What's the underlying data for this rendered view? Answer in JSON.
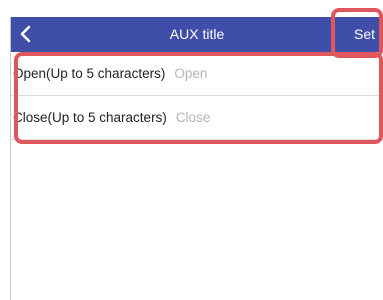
{
  "header": {
    "title": "AUX title",
    "set_label": "Set",
    "back_icon": "chevron-left-icon",
    "background_color": "#3f4ea8"
  },
  "fields": [
    {
      "label": "Open(Up to 5 characters)",
      "value": "",
      "placeholder": "Open"
    },
    {
      "label": "Close(Up to 5 characters)",
      "value": "",
      "placeholder": "Close"
    }
  ],
  "highlight_color": "#e0565b"
}
